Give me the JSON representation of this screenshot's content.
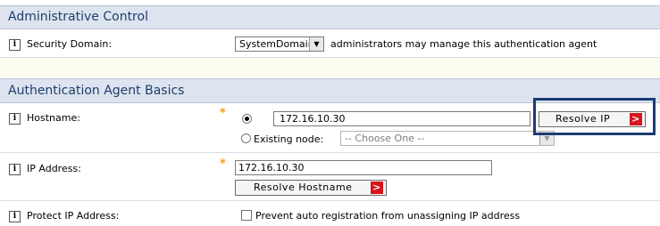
{
  "admin_section": {
    "title": "Administrative Control",
    "security_domain": {
      "label": "Security Domain:",
      "selected": "SystemDomain",
      "trailing_text": "administrators may manage this authentication agent"
    }
  },
  "basics_section": {
    "title": "Authentication Agent Basics",
    "hostname": {
      "label": "Hostname:",
      "value": "172.16.10.30",
      "resolve_button": "Resolve IP",
      "existing_node_label": "Existing node:",
      "existing_node_placeholder": "-- Choose One --"
    },
    "ip_address": {
      "label": "IP Address:",
      "value": "172.16.10.30",
      "resolve_button": "Resolve Hostname"
    },
    "protect_ip": {
      "label": "Protect IP Address:",
      "checkbox_label": "Prevent auto registration from unassigning IP address",
      "checked": false
    }
  },
  "icons": {
    "info": "i",
    "chevron": ">",
    "dropdown_arrow": "▼"
  },
  "colors": {
    "section_header_bg": "#dde4ef",
    "section_title": "#1f3d6b",
    "required_star": "#f0a020",
    "button_chevron": "#d8141c",
    "highlight_border": "#1c3b73",
    "spacer_bg": "#fdfdf0"
  }
}
